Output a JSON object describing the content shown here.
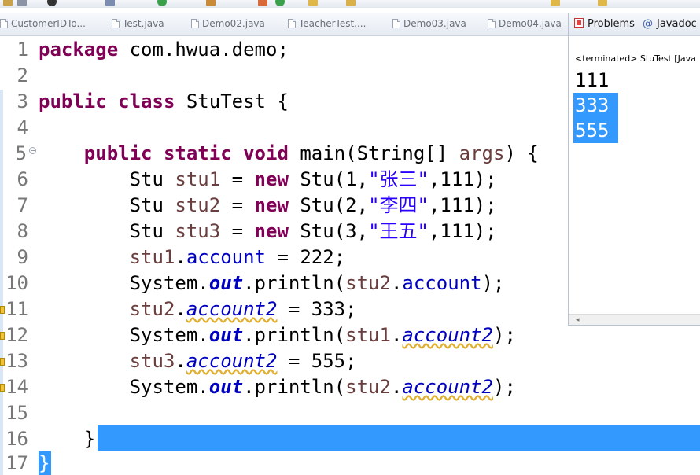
{
  "editor_tabs": [
    {
      "label": "CustomerIDTo...",
      "icon": "java-file-icon"
    },
    {
      "label": "Test.java",
      "icon": "java-file-icon"
    },
    {
      "label": "Demo02.java",
      "icon": "java-file-icon"
    },
    {
      "label": "TeacherTest....",
      "icon": "java-file-icon"
    },
    {
      "label": "Demo03.java",
      "icon": "java-file-icon"
    },
    {
      "label": "Demo04.java",
      "icon": "java-file-icon"
    }
  ],
  "panel": {
    "tabs": [
      {
        "label": "Problems",
        "icon": "problems-icon"
      },
      {
        "label": "Javadoc",
        "icon": "javadoc-icon",
        "prefix": "@"
      }
    ],
    "status": "<terminated> StuTest [Java",
    "output_lines": [
      "111",
      "333",
      "555"
    ]
  },
  "code_lines": [
    {
      "n": "1"
    },
    {
      "n": "2"
    },
    {
      "n": "3"
    },
    {
      "n": "4"
    },
    {
      "n": "5"
    },
    {
      "n": "6"
    },
    {
      "n": "7"
    },
    {
      "n": "8"
    },
    {
      "n": "9"
    },
    {
      "n": "10"
    },
    {
      "n": "11"
    },
    {
      "n": "12"
    },
    {
      "n": "13"
    },
    {
      "n": "14"
    },
    {
      "n": "15"
    },
    {
      "n": "16"
    },
    {
      "n": "17"
    }
  ],
  "code": {
    "l1": {
      "kw": "package",
      "rest": " com.hwua.demo;"
    },
    "l3": {
      "kw1": "public",
      "kw2": "class",
      "rest": " StuTest {"
    },
    "l5": {
      "kw1": "public",
      "kw2": "static",
      "kw3": "void",
      "a": " main(String[] ",
      "var": "args",
      "b": ") {"
    },
    "l6": {
      "t": "Stu ",
      "var": "stu1",
      "eq": " = ",
      "kw": "new",
      "a": " Stu(1,",
      "str": "\"张三\"",
      "b": ",111);"
    },
    "l7": {
      "t": "Stu ",
      "var": "stu2",
      "eq": " = ",
      "kw": "new",
      "a": " Stu(2,",
      "str": "\"李四\"",
      "b": ",111);"
    },
    "l8": {
      "t": "Stu ",
      "var": "stu3",
      "eq": " = ",
      "kw": "new",
      "a": " Stu(3,",
      "str": "\"王五\"",
      "b": ",111);"
    },
    "l9": {
      "var": "stu1",
      "dot": ".",
      "fld": "account",
      "b": " = 222;"
    },
    "l10": {
      "a": "System.",
      "sfld": "out",
      "b": ".println(",
      "var": "stu2",
      "dot": ".",
      "fld": "account",
      "c": ");"
    },
    "l11": {
      "var": "stu2",
      "dot": ".",
      "ifld": "account2",
      "b": " = 333;"
    },
    "l12": {
      "a": "System.",
      "sfld": "out",
      "b": ".println(",
      "var": "stu1",
      "dot": ".",
      "ifld": "account2",
      "c": ");"
    },
    "l13": {
      "var": "stu3",
      "dot": ".",
      "ifld": "account2",
      "b": " = 555;"
    },
    "l14": {
      "a": "System.",
      "sfld": "out",
      "b": ".println(",
      "var": "stu2",
      "dot": ".",
      "ifld": "account2",
      "c": ");"
    },
    "l16": {
      "t": "}"
    },
    "l17": {
      "t": "}"
    }
  },
  "colors": {
    "keyword": "#7f0055",
    "field": "#0000c0",
    "string": "#2a00ff",
    "local_var": "#6a3e3e",
    "selection": "#3399ff"
  }
}
